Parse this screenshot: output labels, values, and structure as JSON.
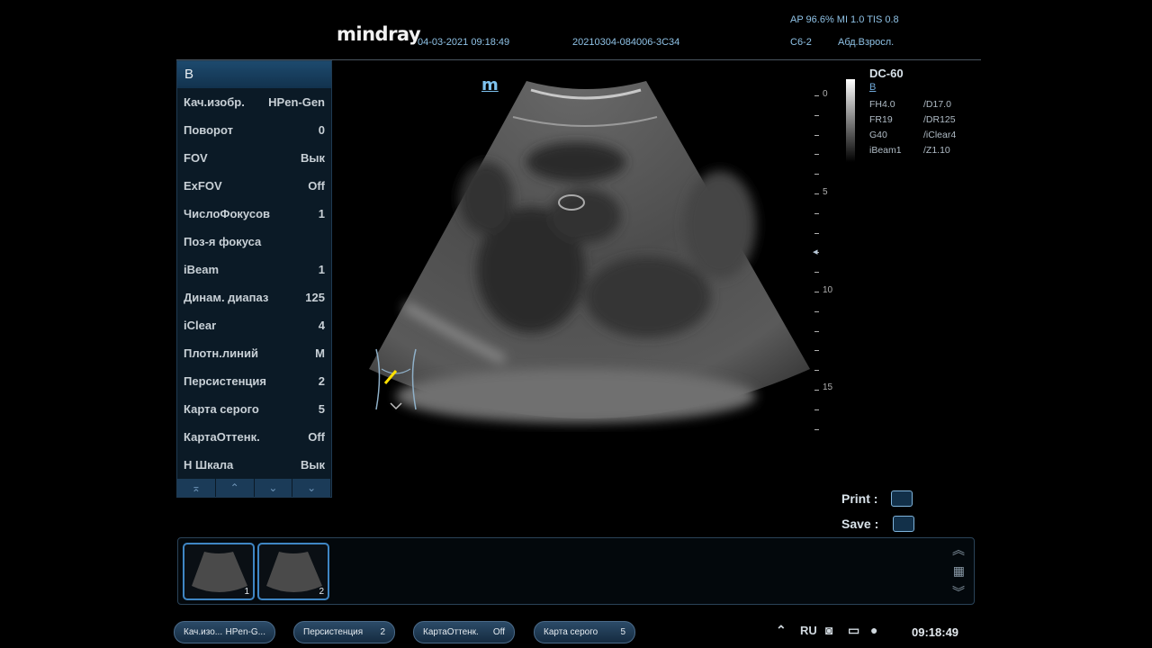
{
  "header": {
    "brand": "mindray",
    "datetime": "04-03-2021 09:18:49",
    "exam_id": "20210304-084006-3C34",
    "acoustic": "AP 96.6%  MI 1.0 TIS 0.8",
    "probe": "C6-2",
    "exam_type": "Абд.Взросл."
  },
  "panel": {
    "title": "B",
    "rows": [
      {
        "label": "Кач.изобр.",
        "value": "HPen-Gen"
      },
      {
        "label": "Поворот",
        "value": "0"
      },
      {
        "label": "FOV",
        "value": "Вык"
      },
      {
        "label": "ExFOV",
        "value": "Off"
      },
      {
        "label": "ЧислоФокусов",
        "value": "1"
      },
      {
        "label": "Поз-я фокуса",
        "value": ""
      },
      {
        "label": "iBeam",
        "value": "1"
      },
      {
        "label": "Динам. диапаз",
        "value": "125"
      },
      {
        "label": "iClear",
        "value": "4"
      },
      {
        "label": "Плотн.линий",
        "value": "M"
      },
      {
        "label": "Персистенция",
        "value": "2"
      },
      {
        "label": "Карта серого",
        "value": "5"
      },
      {
        "label": "КартаОттенк.",
        "value": "Off"
      },
      {
        "label": "H Шкала",
        "value": "Вык"
      }
    ],
    "nav_icons": [
      "first-page-icon",
      "prev-page-icon",
      "next-page-icon",
      "last-page-icon"
    ]
  },
  "image": {
    "marker": "m",
    "depth_scale": [
      "0",
      "5",
      "10",
      "15"
    ]
  },
  "image_params": {
    "probe_name": "DC-60",
    "mode": "B",
    "left": [
      "FH4.0",
      "FR19",
      "G40",
      "iBeam1"
    ],
    "right": [
      "/D17.0",
      "/DR125",
      "/iClear4",
      "/Z1.10"
    ]
  },
  "actions": {
    "print_label": "Print",
    "save_label": "Save",
    "colon": ":"
  },
  "clipboard": {
    "thumbnails": [
      {
        "num": "1"
      },
      {
        "num": "2"
      }
    ]
  },
  "bottom": {
    "pills": [
      {
        "label": "Кач.изо...",
        "value": "HPen-G..."
      },
      {
        "label": "Персистенция",
        "value": "2"
      },
      {
        "label": "КартаОттенк.",
        "value": "Off"
      },
      {
        "label": "Карта серого",
        "value": "5"
      }
    ],
    "lang": "RU",
    "time": "09:18:49"
  }
}
